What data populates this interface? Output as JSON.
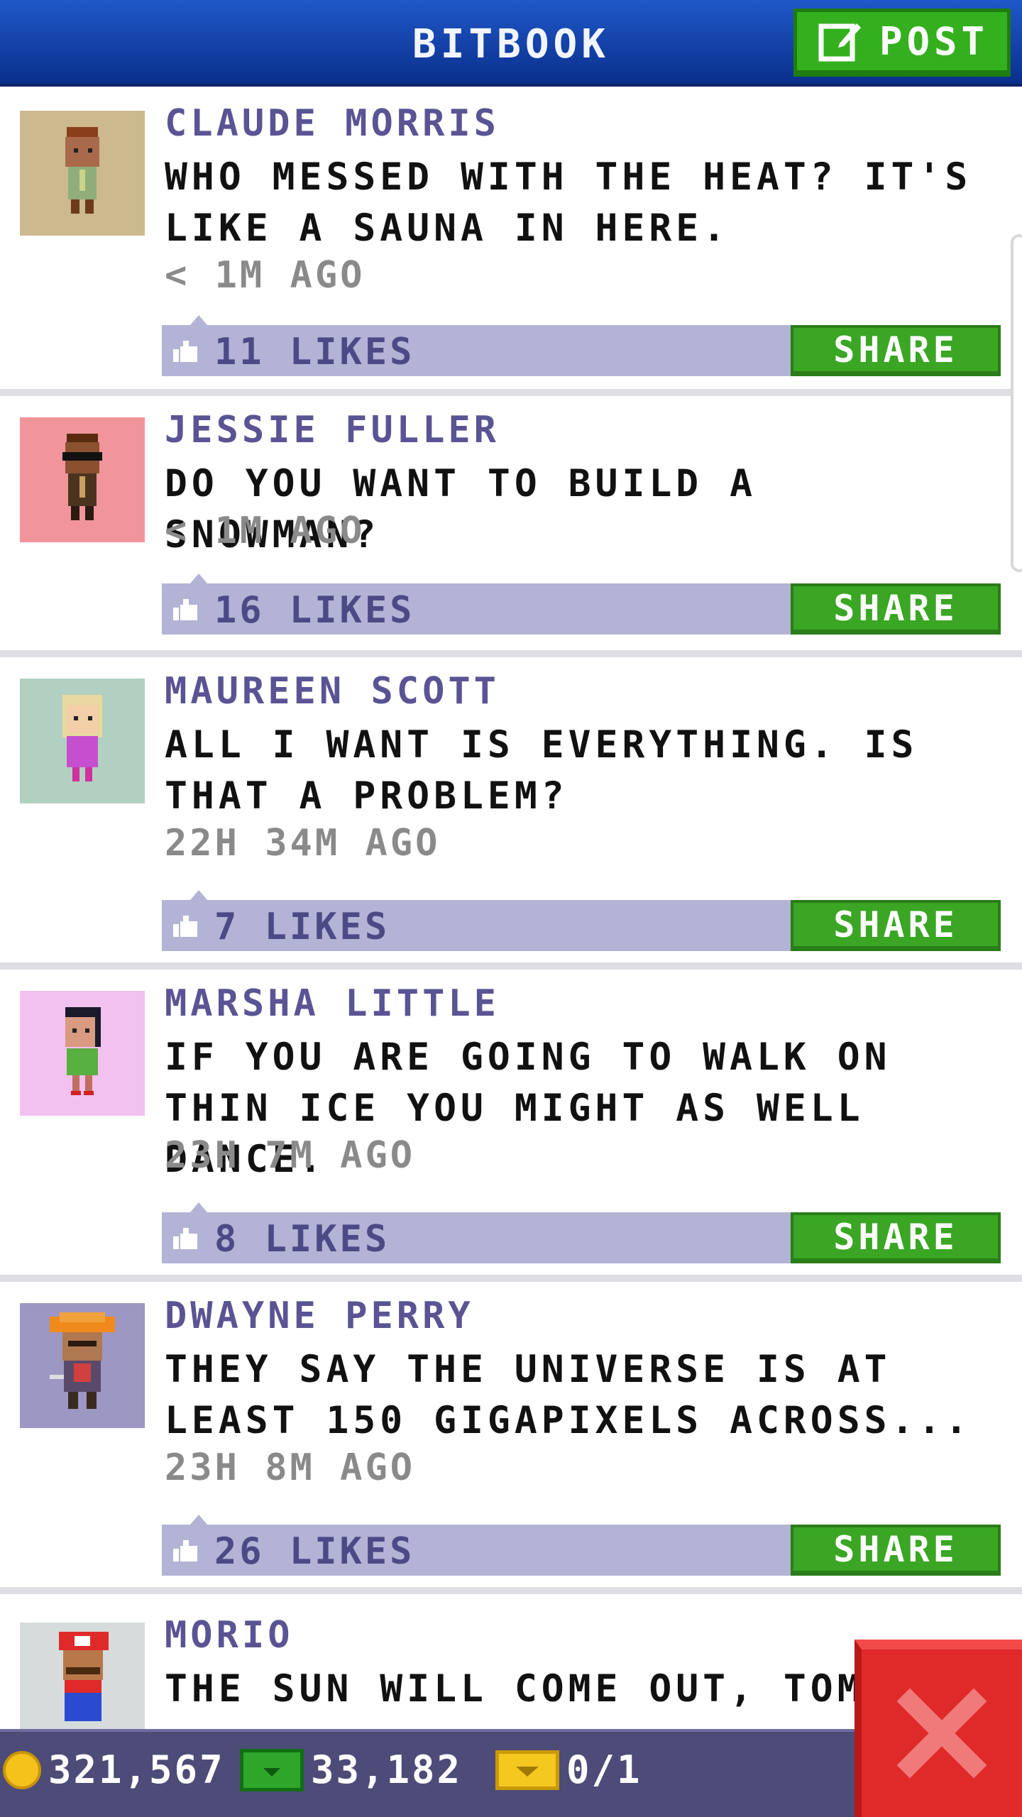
{
  "header": {
    "title": "BITBOOK",
    "post_label": "POST"
  },
  "posts": [
    {
      "author": "CLAUDE MORRIS",
      "message": "WHO MESSED WITH THE HEAT? IT'S LIKE A SAUNA IN HERE.",
      "time": "< 1M AGO",
      "likes": "11 LIKES",
      "share": "SHARE",
      "avatar_bg": "#cdb98e"
    },
    {
      "author": "JESSIE FULLER",
      "message": "DO YOU WANT TO BUILD A SNOWMAN?",
      "time": "< 1M AGO",
      "likes": "16 LIKES",
      "share": "SHARE",
      "avatar_bg": "#f2959b"
    },
    {
      "author": "MAUREEN SCOTT",
      "message": "ALL I WANT IS EVERYTHING. IS THAT A PROBLEM?",
      "time": "22H 34M AGO",
      "likes": "7 LIKES",
      "share": "SHARE",
      "avatar_bg": "#b2d0c1"
    },
    {
      "author": "MARSHA LITTLE",
      "message": "IF YOU ARE GOING TO WALK ON THIN ICE YOU MIGHT AS WELL DANCE.",
      "time": "23H 7M AGO",
      "likes": "8 LIKES",
      "share": "SHARE",
      "avatar_bg": "#f3c1ef"
    },
    {
      "author": "DWAYNE PERRY",
      "message": "THEY SAY THE UNIVERSE IS AT LEAST 150 GIGAPIXELS ACROSS...",
      "time": "23H 8M AGO",
      "likes": "26 LIKES",
      "share": "SHARE",
      "avatar_bg": "#9d97c3"
    },
    {
      "author": "MORIO",
      "message": "THE SUN WILL COME OUT, TOMOR",
      "avatar_bg": "#d6dcdc"
    }
  ],
  "footer": {
    "coins": "321,567",
    "bux": "33,182",
    "tickets": "0/1"
  }
}
